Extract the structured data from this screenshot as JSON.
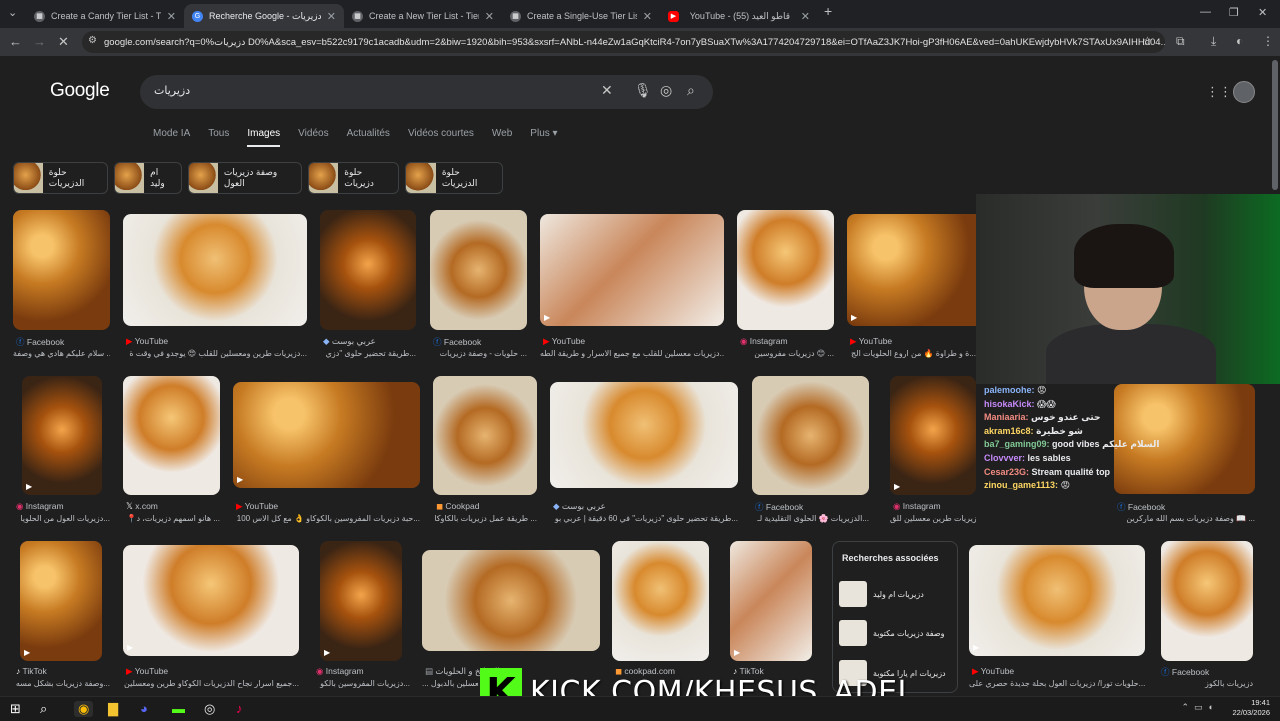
{
  "browser": {
    "tabs": [
      {
        "title": "Create a Candy Tier List - TierM",
        "favicon": "tiermaker-icon",
        "color": "#5f6368"
      },
      {
        "title": "Recherche Google - دزيريات",
        "favicon": "google-icon",
        "color": "#4285f4"
      },
      {
        "title": "Create a New Tier List - TierMa",
        "favicon": "tiermaker-icon",
        "color": "#5f6368"
      },
      {
        "title": "Create a Single-Use Tier List (Pr",
        "favicon": "tiermaker-icon",
        "color": "#5f6368"
      },
      {
        "title": "YouTube - قاطو العيد (55)",
        "favicon": "youtube-icon",
        "color": "#ff0000"
      }
    ],
    "url": "google.com/search?q=0%دزيريات D0%A&sca_esv=b522c9179c1acadb&udm=2&biw=1920&bih=953&sxsrf=ANbL-n44eZw1aGqKtciR4-7on7yBSuaXTw%3A1774204729718&ei=OTfAaZ3JK7Hoi-gP3fH06AE&ved=0ahUKEwjdybHVk7STAxUx9AIHHd04..."
  },
  "google": {
    "logo": "Google",
    "query": "دزيريات",
    "nav_tabs": [
      "Mode IA",
      "Tous",
      "Images",
      "Vidéos",
      "Actualités",
      "Vidéos courtes",
      "Web",
      "Plus ▾"
    ],
    "active_tab": "Images",
    "chips": [
      "حلوة الدزيريات",
      "حلوة دزيريات",
      "وصفة دزيريات العول",
      "ام وليد",
      "حلوة الدزيريات"
    ]
  },
  "results": {
    "row1": [
      {
        "source": "Facebook",
        "caption": "سلام عليكم هادي هي وصفة ...",
        "icon": "facebook-icon"
      },
      {
        "source": "YouTube",
        "caption": "دزيريات طرين ومعسلين للقلب 😍 يوجدو في وقت ة...",
        "icon": "youtube-icon"
      },
      {
        "source": "عربي بوست",
        "caption": "طريقة تحضير حلوى \"دزي...",
        "icon": "arabipost-icon"
      },
      {
        "source": "Facebook",
        "caption": "حلويات - وصفة دزيريات ...",
        "icon": "facebook-icon"
      },
      {
        "source": "YouTube",
        "caption": "دزيريات معسلين للقلب مع جميع الاسرار و طريقة الطه...",
        "icon": "youtube-icon"
      },
      {
        "source": "Instagram",
        "caption": "دزيريات مفروسين 😊 ...",
        "icon": "instagram-icon"
      },
      {
        "source": "YouTube",
        "caption": "ة و طراوة 🔥 من اروع الحلويات الج...",
        "icon": "youtube-icon"
      }
    ],
    "row2": [
      {
        "source": "Instagram",
        "caption": "دزيريات العول من الحلويا...",
        "icon": "instagram-icon"
      },
      {
        "source": "x.com",
        "caption": "📍هانو اسمهم دزيريات، د ...",
        "icon": "x-icon"
      },
      {
        "source": "YouTube",
        "caption": "100 حبة دزيريات المفروسين بالكوكاو 👌 مع كل الاس...",
        "icon": "youtube-icon"
      },
      {
        "source": "Cookpad",
        "caption": "طريقة عمل دزيريات بالكاوكا ...",
        "icon": "cookpad-icon"
      },
      {
        "source": "عربي بوست",
        "caption": "طريقة تحضير حلوى \"دزيريات\" في 60 دقيقة | عربي بو...",
        "icon": "arabipost-icon"
      },
      {
        "source": "Facebook",
        "caption": "الدزيريات 🌸 الحلوى التقليدية لـ...",
        "icon": "facebook-icon"
      },
      {
        "source": "Instagram",
        "caption": "دزيريات طرين معسلين للق...",
        "icon": "instagram-icon"
      },
      {
        "source": "Facebook",
        "caption": "وصفة دزيريات بسم الله ماركرين 📖 ...",
        "icon": "facebook-icon"
      }
    ],
    "row3": [
      {
        "source": "TikTok",
        "caption": "وصفة دزيريات بشكل مسه...",
        "icon": "tiktok-icon"
      },
      {
        "source": "YouTube",
        "caption": "جميع اسرار نجاح الدزيريات الكوكاو طرين ومعسلين...",
        "icon": "youtube-icon"
      },
      {
        "source": "Instagram",
        "caption": "دزيريات المفروسين بالكو...",
        "icon": "instagram-icon"
      },
      {
        "source": "المطبخ و الحلويات",
        "caption": "... و معسلين بالدبول",
        "icon": "kitchen-icon"
      },
      {
        "source": "cookpad.com",
        "caption": "",
        "icon": "cookpad-icon"
      },
      {
        "source": "TikTok",
        "caption": "",
        "icon": "tiktok-icon"
      },
      {
        "source": "YouTube",
        "caption": "حلويات تورا/ دزيريات العول بحلة جديدة حصري على...",
        "icon": "youtube-icon"
      },
      {
        "source": "Facebook",
        "caption": "دزيريات بالكوز",
        "icon": "facebook-icon"
      }
    ]
  },
  "related": {
    "title": "Recherches associées",
    "items": [
      "دزيريات ام وليد",
      "وصفة دزيريات مكتوبة",
      "دزيريات ام يارا مكتوبة"
    ]
  },
  "stream": {
    "chat": [
      {
        "user": "palemoohe:",
        "msg": "😡",
        "color": "#8ab4f8"
      },
      {
        "user": "hisokaKick:",
        "msg": "😱😱",
        "color": "#c58af9"
      },
      {
        "user": "Maniaaria:",
        "msg": "حتى عندو خوس",
        "color": "#f28b82"
      },
      {
        "user": "akram16c8:",
        "msg": "شو خطيرة",
        "color": "#fdd663"
      },
      {
        "user": "ba7_gaming09:",
        "msg": "good vibes السلام عليكم",
        "color": "#81c995"
      },
      {
        "user": "Clovvver:",
        "msg": "les sables",
        "color": "#c58af9"
      },
      {
        "user": "Cesar23G:",
        "msg": "Stream qualité top",
        "color": "#f28b82"
      },
      {
        "user": "zinou_game1113:",
        "msg": "😡",
        "color": "#fdd663"
      }
    ],
    "kick_text": "KICK.COM/KHESUS_ADEL"
  },
  "taskbar": {
    "time": "19:41",
    "date": "22/03/2026"
  }
}
